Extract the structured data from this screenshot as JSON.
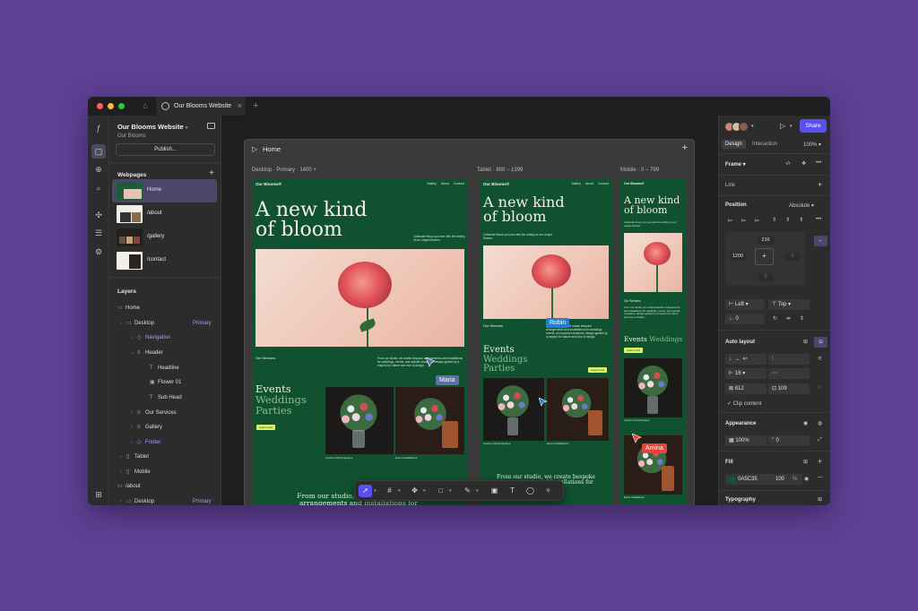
{
  "window": {
    "tab_title": "Our Blooms Website",
    "tab_close": "×",
    "tab_add": "+"
  },
  "left_panel": {
    "project_title": "Our Blooms Website",
    "project_subtitle": "Our Blooms",
    "publish_label": "Publish...",
    "webpages_heading": "Webpages",
    "pages": [
      {
        "label": "Home"
      },
      {
        "label": "/about"
      },
      {
        "label": "/gallery"
      },
      {
        "label": "/contact"
      }
    ],
    "layers_heading": "Layers",
    "layers": [
      {
        "label": "Home",
        "icon": "file-icon"
      },
      {
        "label": "Desktop",
        "icon": "desktop-icon",
        "tag": "Primary"
      },
      {
        "label": "Navigation",
        "icon": "component-icon"
      },
      {
        "label": "Header",
        "icon": "stack-icon"
      },
      {
        "label": "Headline",
        "icon": "text-icon"
      },
      {
        "label": "Flower 01",
        "icon": "image-icon"
      },
      {
        "label": "Sub Head",
        "icon": "text-icon"
      },
      {
        "label": "Our Services",
        "icon": "stack-icon"
      },
      {
        "label": "Gallery",
        "icon": "stack-icon"
      },
      {
        "label": "Footer",
        "icon": "component-icon"
      },
      {
        "label": "Tablet",
        "icon": "tablet-icon"
      },
      {
        "label": "Mobile",
        "icon": "mobile-icon"
      },
      {
        "label": "/about",
        "icon": "file-icon"
      },
      {
        "label": "Desktop",
        "icon": "desktop-icon",
        "tag": "Primary"
      }
    ]
  },
  "canvas": {
    "frame_title": "Home",
    "frame_add": "+",
    "breakpoints": [
      {
        "label": "Desktop · Primary · 1400 +"
      },
      {
        "label": "Tablet · 800 – 1399"
      },
      {
        "label": "Mobile · 0 – 799"
      }
    ],
    "site": {
      "logo": "Our Blooms®",
      "nav": "Gallery About Contact",
      "headline_line1": "A new kind",
      "headline_line2": "of bloom",
      "blurb": "Celebrate those you love with the artistry of our unique flowers.",
      "services_label": "Our Services",
      "services_blurb": "From our studio, we create bespoke arrangements and installations for weddings, events, and special occasions, always guided by a respect for nature and love of design.",
      "events": "Events",
      "weddings": "Weddings",
      "parties": "Parties",
      "cta": "Learn more",
      "caption1": "Custom Floral Designs",
      "caption2": "Event Installations",
      "footer_text_line1": "From our studio, we create bespoke",
      "footer_text_line2": "arrangements and installations for"
    },
    "cursors": [
      {
        "name": "Robin",
        "color": "#1e7fd6"
      },
      {
        "name": "Maria",
        "color": "#5d6fa8"
      },
      {
        "name": "Amina",
        "color": "#e2463b"
      }
    ]
  },
  "toolbar": {
    "tools": [
      "select-icon",
      "frame-icon",
      "component-icon",
      "shape-icon",
      "pen-icon",
      "image-icon",
      "text-icon",
      "comment-icon",
      "ai-icon"
    ]
  },
  "right_panel": {
    "share_label": "Share",
    "tabs": [
      "Design",
      "Interaction"
    ],
    "zoom": "100%",
    "frame_label": "Frame",
    "link_label": "Link",
    "position_heading": "Position",
    "position_mode": "Absolute",
    "constraints": {
      "top": "216",
      "left": "1200",
      "right": "0",
      "bottom": "0"
    },
    "h_anchor": "Left",
    "v_anchor": "Top",
    "rotation": "0",
    "auto_layout_heading": "Auto layout",
    "gap": "16",
    "width": "612",
    "height": "109",
    "clip_content": "Clip content",
    "appearance_heading": "Appearance",
    "opacity": "100%",
    "radius": "0",
    "fill_heading": "Fill",
    "fill_hex": "0A5C35",
    "fill_opacity": "100",
    "fill_unit": "%",
    "typography_heading": "Typography",
    "accent_color": "#5a4ff0"
  }
}
